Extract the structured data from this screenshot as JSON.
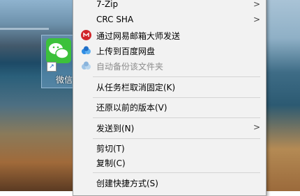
{
  "desktop": {
    "icon_label": "微信"
  },
  "menu": {
    "items": [
      {
        "label": "7-Zip",
        "submenu": true
      },
      {
        "label": "CRC SHA",
        "submenu": true
      },
      {
        "label": "通过网易邮箱大师发送",
        "icon": "netease-mail-icon"
      },
      {
        "label": "上传到百度网盘",
        "icon": "baidu-netdisk-icon"
      },
      {
        "label": "自动备份该文件夹",
        "icon": "baidu-netdisk-icon",
        "disabled": true
      },
      {
        "label": "从任务栏取消固定(K)"
      },
      {
        "label": "还原以前的版本(V)"
      },
      {
        "label": "发送到(N)",
        "submenu": true
      },
      {
        "label": "剪切(T)"
      },
      {
        "label": "复制(C)"
      },
      {
        "label": "创建快捷方式(S)"
      }
    ],
    "submenu_arrow": ">"
  },
  "colors": {
    "menu_bg": "#f2f2f2",
    "netease_red": "#d0262b",
    "baidu_blue": "#2f8de4"
  }
}
